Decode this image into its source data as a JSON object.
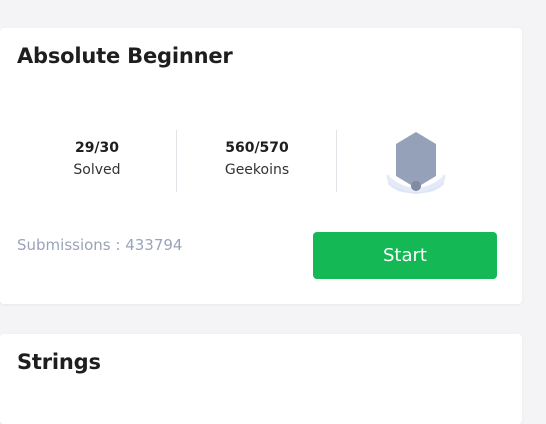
{
  "cards": [
    {
      "title": "Absolute Beginner",
      "stats": {
        "solved": {
          "value": "29/30",
          "label": "Solved"
        },
        "geekoins": {
          "value": "560/570",
          "label": "Geekoins"
        }
      },
      "badge_icon": "hexagon-medal-badge-icon",
      "submissions_label": "Submissions :",
      "submissions_count": "433794",
      "submissions_text": "Submissions : 433794",
      "start_label": "Start"
    },
    {
      "title": "Strings"
    }
  ],
  "colors": {
    "background": "#f4f4f6",
    "card": "#ffffff",
    "start_button": "#14b854",
    "muted_text": "#9aa3b8",
    "badge_gray": "#95a0b9",
    "badge_ribbon": "#dde5f7"
  }
}
